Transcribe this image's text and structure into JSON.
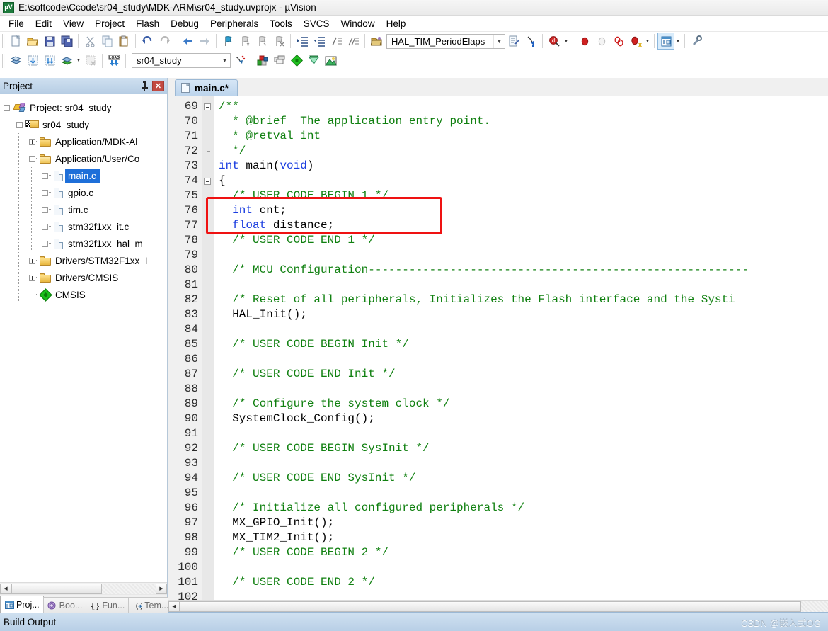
{
  "window": {
    "title": "E:\\softcode\\Ccode\\sr04_study\\MDK-ARM\\sr04_study.uvprojx - µVision",
    "app_icon": "uvision-icon",
    "app_icon_text": "µV"
  },
  "menubar": {
    "items": [
      {
        "label": "File",
        "name": "menu-file"
      },
      {
        "label": "Edit",
        "name": "menu-edit"
      },
      {
        "label": "View",
        "name": "menu-view"
      },
      {
        "label": "Project",
        "name": "menu-project"
      },
      {
        "label": "Flash",
        "name": "menu-flash"
      },
      {
        "label": "Debug",
        "name": "menu-debug"
      },
      {
        "label": "Peripherals",
        "name": "menu-peripherals"
      },
      {
        "label": "Tools",
        "name": "menu-tools"
      },
      {
        "label": "SVCS",
        "name": "menu-svcs"
      },
      {
        "label": "Window",
        "name": "menu-window"
      },
      {
        "label": "Help",
        "name": "menu-help"
      }
    ]
  },
  "toolbar_main": {
    "buttons": [
      {
        "name": "new-file-icon",
        "title": "New"
      },
      {
        "name": "open-file-icon",
        "title": "Open"
      },
      {
        "name": "save-icon",
        "title": "Save"
      },
      {
        "name": "save-all-icon",
        "title": "Save All"
      },
      {
        "name": "cut-icon",
        "title": "Cut"
      },
      {
        "name": "copy-icon",
        "title": "Copy"
      },
      {
        "name": "paste-icon",
        "title": "Paste"
      },
      {
        "name": "undo-icon",
        "title": "Undo"
      },
      {
        "name": "redo-icon",
        "title": "Redo"
      },
      {
        "name": "navigate-back-icon",
        "title": "Back"
      },
      {
        "name": "navigate-forward-icon",
        "title": "Forward"
      },
      {
        "name": "bookmark-toggle-icon",
        "title": "Insert/Remove Bookmark"
      },
      {
        "name": "bookmark-prev-icon",
        "title": "Previous Bookmark"
      },
      {
        "name": "bookmark-next-icon",
        "title": "Next Bookmark"
      },
      {
        "name": "bookmark-clear-icon",
        "title": "Clear All Bookmarks"
      },
      {
        "name": "indent-right-icon",
        "title": "Indent"
      },
      {
        "name": "indent-left-icon",
        "title": "Unindent"
      },
      {
        "name": "comment-icon",
        "title": "Comment"
      },
      {
        "name": "uncomment-icon",
        "title": "Uncomment"
      },
      {
        "name": "open-project-icon",
        "title": "Open Project"
      }
    ],
    "function_combo_value": "HAL_TIM_PeriodElaps",
    "after_combo": [
      {
        "name": "goto-definition-icon",
        "title": "Go To Definition"
      },
      {
        "name": "find-in-files-icon",
        "title": "Find in Files"
      },
      {
        "name": "debug-start-icon",
        "title": "Start/Stop Debug Session"
      },
      {
        "name": "breakpoint-insert-icon",
        "title": "Insert/Remove Breakpoint"
      },
      {
        "name": "breakpoint-disable-icon",
        "title": "Enable/Disable Breakpoint"
      },
      {
        "name": "breakpoint-disable-all-icon",
        "title": "Disable All Breakpoints"
      },
      {
        "name": "breakpoint-kill-all-icon",
        "title": "Kill All Breakpoints"
      },
      {
        "name": "project-window-icon",
        "title": "Project Window"
      },
      {
        "name": "configuration-wizard-icon",
        "title": "Configuration Wizard"
      }
    ]
  },
  "toolbar_build": {
    "buttons": [
      {
        "name": "translate-icon",
        "title": "Translate"
      },
      {
        "name": "build-icon",
        "title": "Build"
      },
      {
        "name": "rebuild-icon",
        "title": "Rebuild"
      },
      {
        "name": "batch-build-icon",
        "title": "Batch Build"
      },
      {
        "name": "stop-build-icon",
        "title": "Stop Build"
      },
      {
        "name": "download-icon",
        "title": "Download"
      }
    ],
    "target_combo_value": "sr04_study",
    "after_combo": [
      {
        "name": "target-options-icon",
        "title": "Options for Target"
      },
      {
        "name": "manage-runtime-icon",
        "title": "Manage Run-Time Environment"
      },
      {
        "name": "multi-project-icon",
        "title": "Manage Multi-Project"
      },
      {
        "name": "components-icon",
        "title": "Select Software Packs"
      },
      {
        "name": "pack-installer-icon",
        "title": "Pack Installer"
      },
      {
        "name": "pack-browse-icon",
        "title": "Packs Browse"
      }
    ]
  },
  "project_panel": {
    "title": "Project",
    "pin_icon": "pin-icon",
    "close_icon": "close-icon",
    "tree": [
      {
        "label": "Project: sr04_study",
        "depth": 0,
        "icon": "project-root-icon",
        "state": "expanded",
        "selected": false
      },
      {
        "label": "sr04_study",
        "depth": 1,
        "icon": "target-icon",
        "state": "expanded",
        "selected": false
      },
      {
        "label": "Application/MDK-Al",
        "depth": 2,
        "icon": "folder-icon",
        "state": "collapsed",
        "selected": false
      },
      {
        "label": "Application/User/Co",
        "depth": 2,
        "icon": "folder-open-icon",
        "state": "expanded",
        "selected": false
      },
      {
        "label": "main.c",
        "depth": 3,
        "icon": "c-file-icon",
        "state": "collapsed",
        "selected": true
      },
      {
        "label": "gpio.c",
        "depth": 3,
        "icon": "c-file-icon",
        "state": "collapsed",
        "selected": false
      },
      {
        "label": "tim.c",
        "depth": 3,
        "icon": "c-file-icon",
        "state": "collapsed",
        "selected": false
      },
      {
        "label": "stm32f1xx_it.c",
        "depth": 3,
        "icon": "c-file-icon",
        "state": "collapsed",
        "selected": false
      },
      {
        "label": "stm32f1xx_hal_m",
        "depth": 3,
        "icon": "c-file-icon",
        "state": "collapsed",
        "selected": false
      },
      {
        "label": "Drivers/STM32F1xx_I",
        "depth": 2,
        "icon": "folder-icon",
        "state": "collapsed",
        "selected": false
      },
      {
        "label": "Drivers/CMSIS",
        "depth": 2,
        "icon": "folder-icon",
        "state": "collapsed",
        "selected": false
      },
      {
        "label": "CMSIS",
        "depth": 2,
        "icon": "cmsis-icon",
        "state": "leaf",
        "selected": false
      }
    ],
    "bottom_tabs": [
      {
        "label": "Proj...",
        "name": "tab-project",
        "icon": "project-window-icon",
        "selected": true
      },
      {
        "label": "Boo...",
        "name": "tab-books",
        "icon": "books-icon",
        "selected": false
      },
      {
        "label": "Fun...",
        "name": "tab-functions",
        "icon": "functions-icon",
        "selected": false
      },
      {
        "label": "Tem...",
        "name": "tab-templates",
        "icon": "templates-icon",
        "selected": false
      }
    ]
  },
  "editor": {
    "tabs": [
      {
        "label": "main.c*",
        "name": "doc-tab-main-c",
        "icon": "c-file-icon",
        "active": true
      }
    ],
    "first_line": 69,
    "annotation": {
      "type": "red-rectangle",
      "lines": [
        76,
        77
      ],
      "color": "#ef1212"
    },
    "lines": [
      {
        "n": 69,
        "fold": "start",
        "tokens": [
          {
            "t": "/**",
            "c": "cmt"
          }
        ]
      },
      {
        "n": 70,
        "fold": "mid",
        "tokens": [
          {
            "t": "  * @brief  The application entry point.",
            "c": "cmt"
          }
        ]
      },
      {
        "n": 71,
        "fold": "mid",
        "tokens": [
          {
            "t": "  * @retval int",
            "c": "cmt"
          }
        ]
      },
      {
        "n": 72,
        "fold": "end",
        "tokens": [
          {
            "t": "  */",
            "c": "cmt"
          }
        ]
      },
      {
        "n": 73,
        "fold": "none",
        "tokens": [
          {
            "t": "int",
            "c": "kw"
          },
          {
            "t": " main",
            "c": "txt"
          },
          {
            "t": "(",
            "c": "txt"
          },
          {
            "t": "void",
            "c": "kw"
          },
          {
            "t": ")",
            "c": "txt"
          }
        ]
      },
      {
        "n": 74,
        "fold": "start2",
        "tokens": [
          {
            "t": "{",
            "c": "txt"
          }
        ]
      },
      {
        "n": 75,
        "fold": "mid2",
        "tokens": [
          {
            "t": "  /* USER CODE BEGIN 1 */",
            "c": "cmt"
          }
        ]
      },
      {
        "n": 76,
        "fold": "mid2",
        "tokens": [
          {
            "t": "  ",
            "c": "txt"
          },
          {
            "t": "int",
            "c": "kw"
          },
          {
            "t": " cnt;",
            "c": "txt"
          }
        ]
      },
      {
        "n": 77,
        "fold": "mid2",
        "tokens": [
          {
            "t": "  ",
            "c": "txt"
          },
          {
            "t": "float",
            "c": "kw"
          },
          {
            "t": " distance;",
            "c": "txt"
          }
        ]
      },
      {
        "n": 78,
        "fold": "mid2",
        "tokens": [
          {
            "t": "  /* USER CODE END 1 */",
            "c": "cmt"
          }
        ]
      },
      {
        "n": 79,
        "fold": "mid2",
        "tokens": []
      },
      {
        "n": 80,
        "fold": "mid2",
        "tokens": [
          {
            "t": "  /* MCU Configuration--------------------------------------------------------",
            "c": "cmt"
          }
        ]
      },
      {
        "n": 81,
        "fold": "mid2",
        "tokens": []
      },
      {
        "n": 82,
        "fold": "mid2",
        "tokens": [
          {
            "t": "  /* Reset of all peripherals, Initializes the Flash interface and the Systi",
            "c": "cmt"
          }
        ]
      },
      {
        "n": 83,
        "fold": "mid2",
        "tokens": [
          {
            "t": "  HAL_Init();",
            "c": "txt"
          }
        ]
      },
      {
        "n": 84,
        "fold": "mid2",
        "tokens": []
      },
      {
        "n": 85,
        "fold": "mid2",
        "tokens": [
          {
            "t": "  /* USER CODE BEGIN Init */",
            "c": "cmt"
          }
        ]
      },
      {
        "n": 86,
        "fold": "mid2",
        "tokens": []
      },
      {
        "n": 87,
        "fold": "mid2",
        "tokens": [
          {
            "t": "  /* USER CODE END Init */",
            "c": "cmt"
          }
        ]
      },
      {
        "n": 88,
        "fold": "mid2",
        "tokens": []
      },
      {
        "n": 89,
        "fold": "mid2",
        "tokens": [
          {
            "t": "  /* Configure the system clock */",
            "c": "cmt"
          }
        ]
      },
      {
        "n": 90,
        "fold": "mid2",
        "tokens": [
          {
            "t": "  SystemClock_Config();",
            "c": "txt"
          }
        ]
      },
      {
        "n": 91,
        "fold": "mid2",
        "tokens": []
      },
      {
        "n": 92,
        "fold": "mid2",
        "tokens": [
          {
            "t": "  /* USER CODE BEGIN SysInit */",
            "c": "cmt"
          }
        ]
      },
      {
        "n": 93,
        "fold": "mid2",
        "tokens": []
      },
      {
        "n": 94,
        "fold": "mid2",
        "tokens": [
          {
            "t": "  /* USER CODE END SysInit */",
            "c": "cmt"
          }
        ]
      },
      {
        "n": 95,
        "fold": "mid2",
        "tokens": []
      },
      {
        "n": 96,
        "fold": "mid2",
        "tokens": [
          {
            "t": "  /* Initialize all configured peripherals */",
            "c": "cmt"
          }
        ]
      },
      {
        "n": 97,
        "fold": "mid2",
        "tokens": [
          {
            "t": "  MX_GPIO_Init();",
            "c": "txt"
          }
        ]
      },
      {
        "n": 98,
        "fold": "mid2",
        "tokens": [
          {
            "t": "  MX_TIM2_Init();",
            "c": "txt"
          }
        ]
      },
      {
        "n": 99,
        "fold": "mid2",
        "tokens": [
          {
            "t": "  /* USER CODE BEGIN 2 */",
            "c": "cmt"
          }
        ]
      },
      {
        "n": 100,
        "fold": "mid2",
        "tokens": []
      },
      {
        "n": 101,
        "fold": "mid2",
        "tokens": [
          {
            "t": "  /* USER CODE END 2 */",
            "c": "cmt"
          }
        ]
      },
      {
        "n": 102,
        "fold": "mid2",
        "tokens": []
      }
    ]
  },
  "build_output": {
    "title": "Build Output",
    "watermark": "CSDN @嵌入式OG"
  },
  "colors": {
    "selection_blue": "#1e6fd9",
    "comment_green": "#108010",
    "keyword_blue": "#1a3de0",
    "annotation_red": "#ef1212",
    "panel_header": "#b6cde4"
  }
}
